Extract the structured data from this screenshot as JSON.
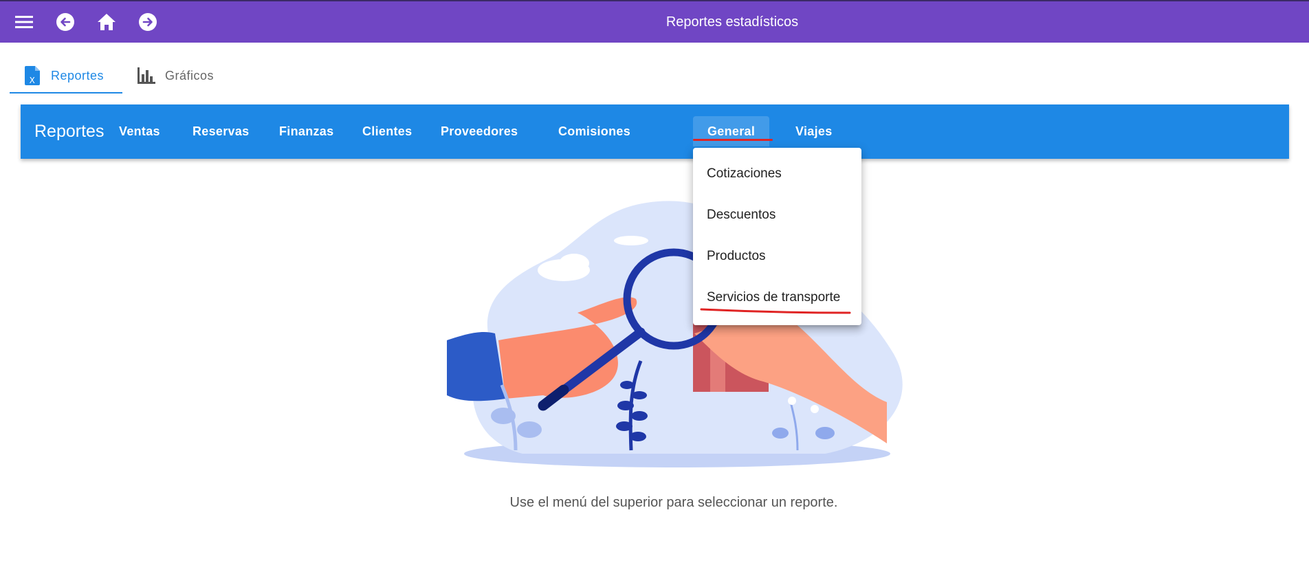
{
  "topbar": {
    "title": "Reportes estadísticos",
    "icons": [
      "menu-icon",
      "back-icon",
      "home-icon",
      "forward-icon"
    ],
    "color": "#7046c4"
  },
  "tabs": [
    {
      "label": "Reportes",
      "icon": "excel-file-icon",
      "active": true
    },
    {
      "label": "Gráficos",
      "icon": "bar-chart-icon",
      "active": false
    }
  ],
  "reports_bar": {
    "title": "Reportes",
    "color": "#1e88e5",
    "items": [
      "Ventas",
      "Reservas",
      "Finanzas",
      "Clientes",
      "Proveedores",
      "Comisiones",
      "General",
      "Viajes"
    ],
    "selected": "General"
  },
  "dropdown": {
    "items": [
      "Cotizaciones",
      "Descuentos",
      "Productos",
      "Servicios de transporte"
    ]
  },
  "main": {
    "hint": "Use el menú del superior para seleccionar un reporte."
  },
  "colors": {
    "annotation_red": "#e02424",
    "accent_blue": "#1e88e5"
  }
}
